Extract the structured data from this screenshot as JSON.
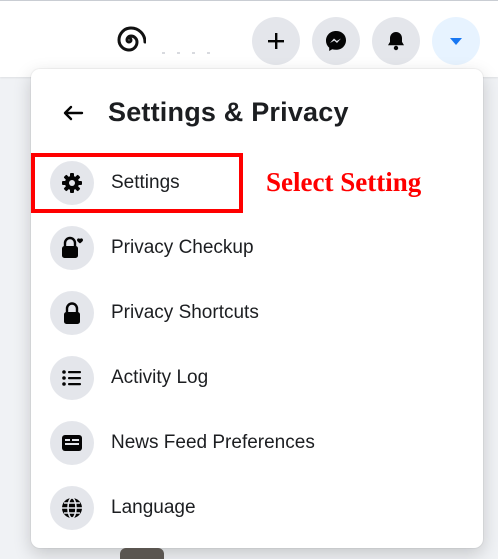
{
  "topbar": {
    "icons": [
      {
        "name": "plus-icon",
        "label": "+"
      },
      {
        "name": "messenger-icon"
      },
      {
        "name": "bell-icon"
      },
      {
        "name": "caret-down-icon"
      }
    ],
    "accent_color": "#1877f2"
  },
  "menu": {
    "title": "Settings & Privacy",
    "items": [
      {
        "label": "Settings",
        "icon": "gear-icon"
      },
      {
        "label": "Privacy Checkup",
        "icon": "lock-heart-icon"
      },
      {
        "label": "Privacy Shortcuts",
        "icon": "lock-icon"
      },
      {
        "label": "Activity Log",
        "icon": "list-icon"
      },
      {
        "label": "News Feed Preferences",
        "icon": "newsfeed-icon"
      },
      {
        "label": "Language",
        "icon": "globe-icon"
      }
    ]
  },
  "annotation": {
    "text": "Select Setting",
    "color": "#ff0000"
  }
}
